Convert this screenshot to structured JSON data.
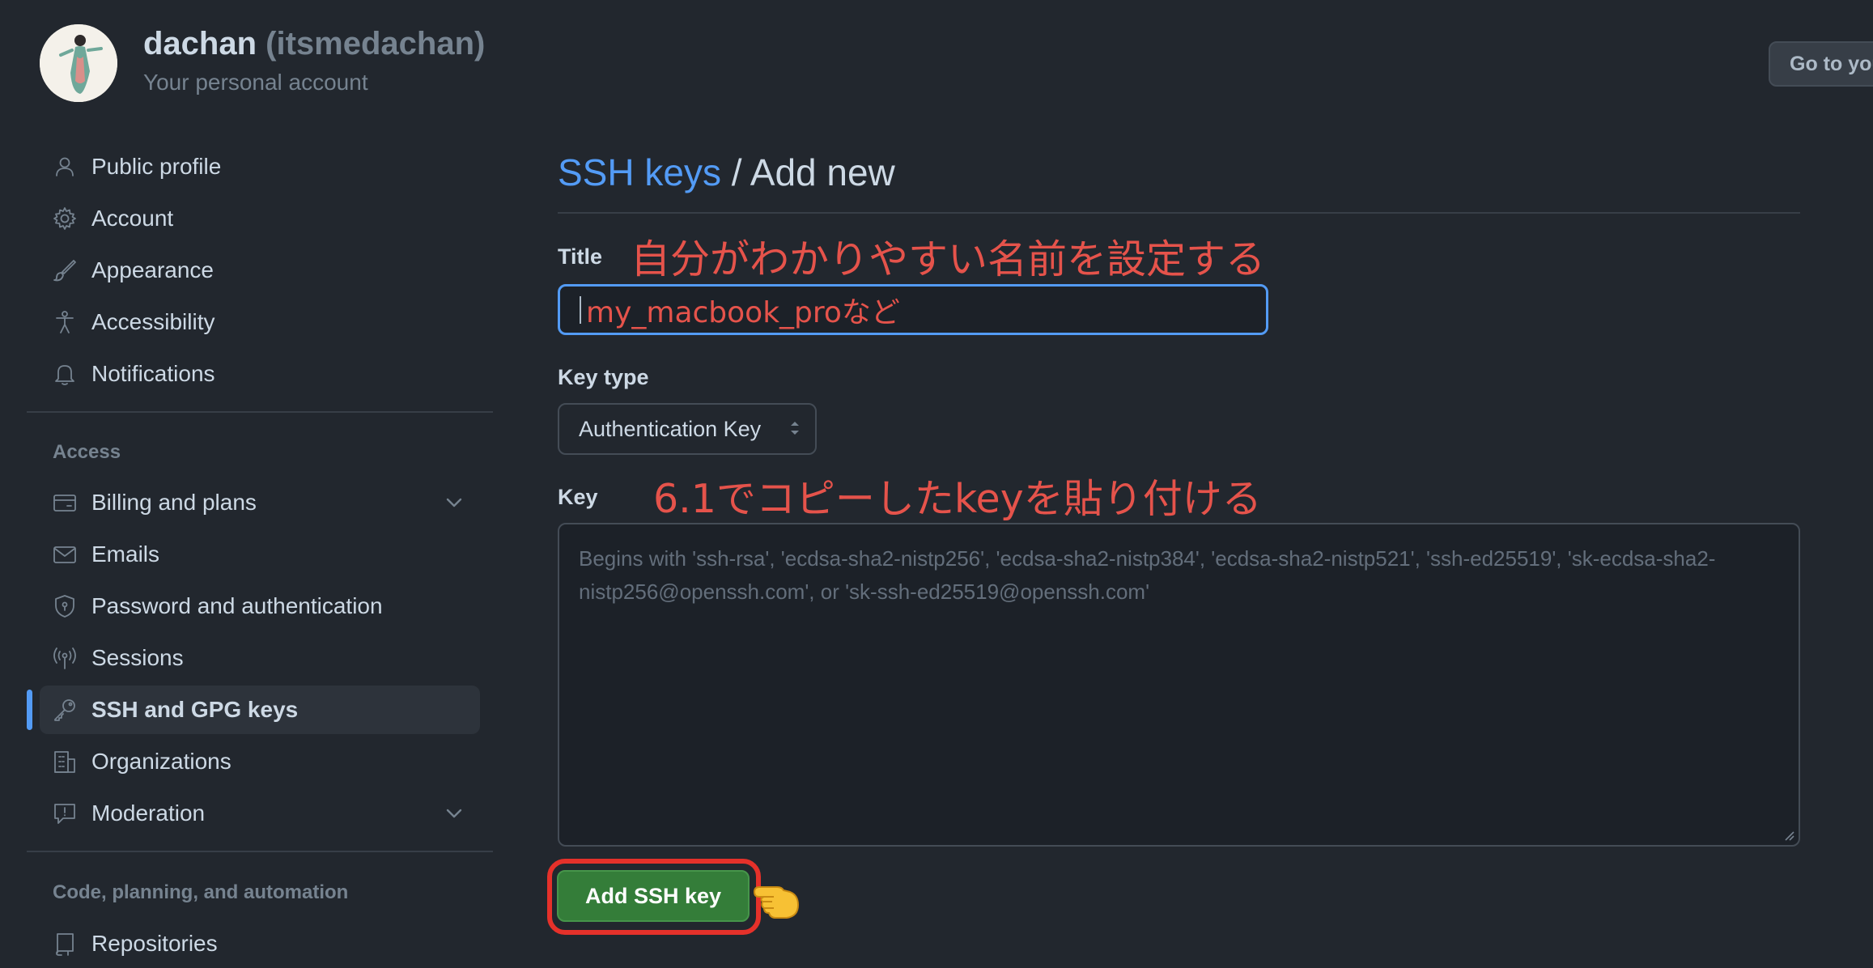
{
  "account": {
    "name": "dachan",
    "handle": "(itsmedachan)",
    "subtitle": "Your personal account",
    "goto_button": "Go to you"
  },
  "sidebar": {
    "items": [
      {
        "label": "Public profile",
        "icon": "person-icon"
      },
      {
        "label": "Account",
        "icon": "gear-icon"
      },
      {
        "label": "Appearance",
        "icon": "paintbrush-icon"
      },
      {
        "label": "Accessibility",
        "icon": "accessibility-icon"
      },
      {
        "label": "Notifications",
        "icon": "bell-icon"
      }
    ],
    "access_heading": "Access",
    "access_items": [
      {
        "label": "Billing and plans",
        "icon": "credit-card-icon"
      },
      {
        "label": "Emails",
        "icon": "mail-icon"
      },
      {
        "label": "Password and authentication",
        "icon": "shield-lock-icon"
      },
      {
        "label": "Sessions",
        "icon": "broadcast-icon"
      },
      {
        "label": "SSH and GPG keys",
        "icon": "key-icon",
        "active": true
      },
      {
        "label": "Organizations",
        "icon": "organization-icon"
      },
      {
        "label": "Moderation",
        "icon": "report-icon"
      }
    ],
    "code_heading": "Code, planning, and automation",
    "code_items": [
      {
        "label": "Repositories",
        "icon": "repo-icon"
      }
    ]
  },
  "main": {
    "breadcrumb_link": "SSH keys",
    "breadcrumb_rest": " / Add new",
    "title_label": "Title",
    "title_annotation": "自分がわかりやすい名前を設定する",
    "title_value": "my_macbook_proなど",
    "key_type_label": "Key type",
    "key_type_value": "Authentication Key",
    "key_label": "Key",
    "key_annotation": "6.1でコピーしたkeyを貼り付ける",
    "key_placeholder": "Begins with 'ssh-rsa', 'ecdsa-sha2-nistp256', 'ecdsa-sha2-nistp384', 'ecdsa-sha2-nistp521', 'ssh-ed25519', 'sk-ecdsa-sha2-nistp256@openssh.com', or 'sk-ssh-ed25519@openssh.com'",
    "submit_label": "Add SSH key"
  },
  "colors": {
    "background": "#22272e",
    "link": "#539bf5",
    "annotation": "#e5534b",
    "primary_button": "#347d39",
    "highlight_frame": "#e5312a"
  }
}
